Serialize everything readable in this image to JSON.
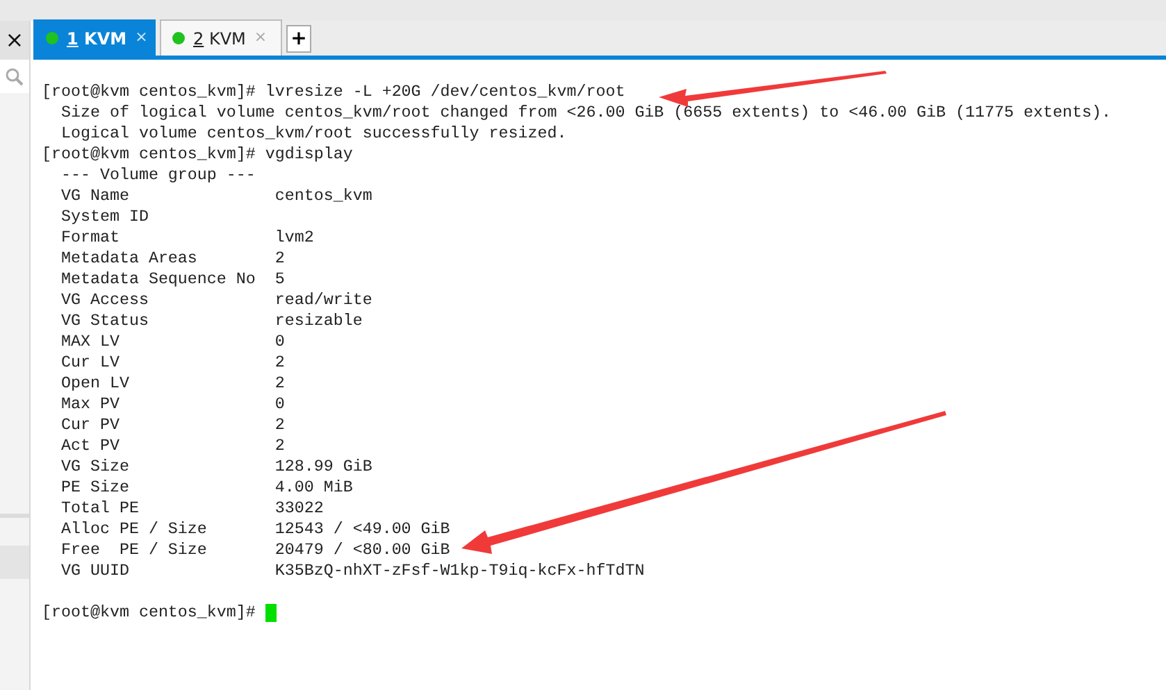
{
  "tabs": [
    {
      "number": "1",
      "label": "KVM",
      "selected": true,
      "color": "#1fc21f",
      "close": "×"
    },
    {
      "number": "2",
      "label": "KVM",
      "selected": false,
      "color": "#1fc21f",
      "close": "×"
    }
  ],
  "new_tab_button": "+",
  "sidebar": {
    "close": "×"
  },
  "terminal": {
    "lines": [
      "[root@kvm centos_kvm]# lvresize -L +20G /dev/centos_kvm/root",
      "  Size of logical volume centos_kvm/root changed from <26.00 GiB (6655 extents) to <46.00 GiB (11775 extents).",
      "  Logical volume centos_kvm/root successfully resized.",
      "[root@kvm centos_kvm]# vgdisplay",
      "  --- Volume group ---",
      "  VG Name               centos_kvm",
      "  System ID",
      "  Format                lvm2",
      "  Metadata Areas        2",
      "  Metadata Sequence No  5",
      "  VG Access             read/write",
      "  VG Status             resizable",
      "  MAX LV                0",
      "  Cur LV                2",
      "  Open LV               2",
      "  Max PV                0",
      "  Cur PV                2",
      "  Act PV                2",
      "  VG Size               128.99 GiB",
      "  PE Size               4.00 MiB",
      "  Total PE              33022",
      "  Alloc PE / Size       12543 / <49.00 GiB",
      "  Free  PE / Size       20479 / <80.00 GiB",
      "  VG UUID               K35BzQ-nhXT-zFsf-W1kp-T9iq-kcFx-hfTdTN"
    ],
    "prompt": "[root@kvm centos_kvm]# ",
    "cursor_visible": true
  }
}
